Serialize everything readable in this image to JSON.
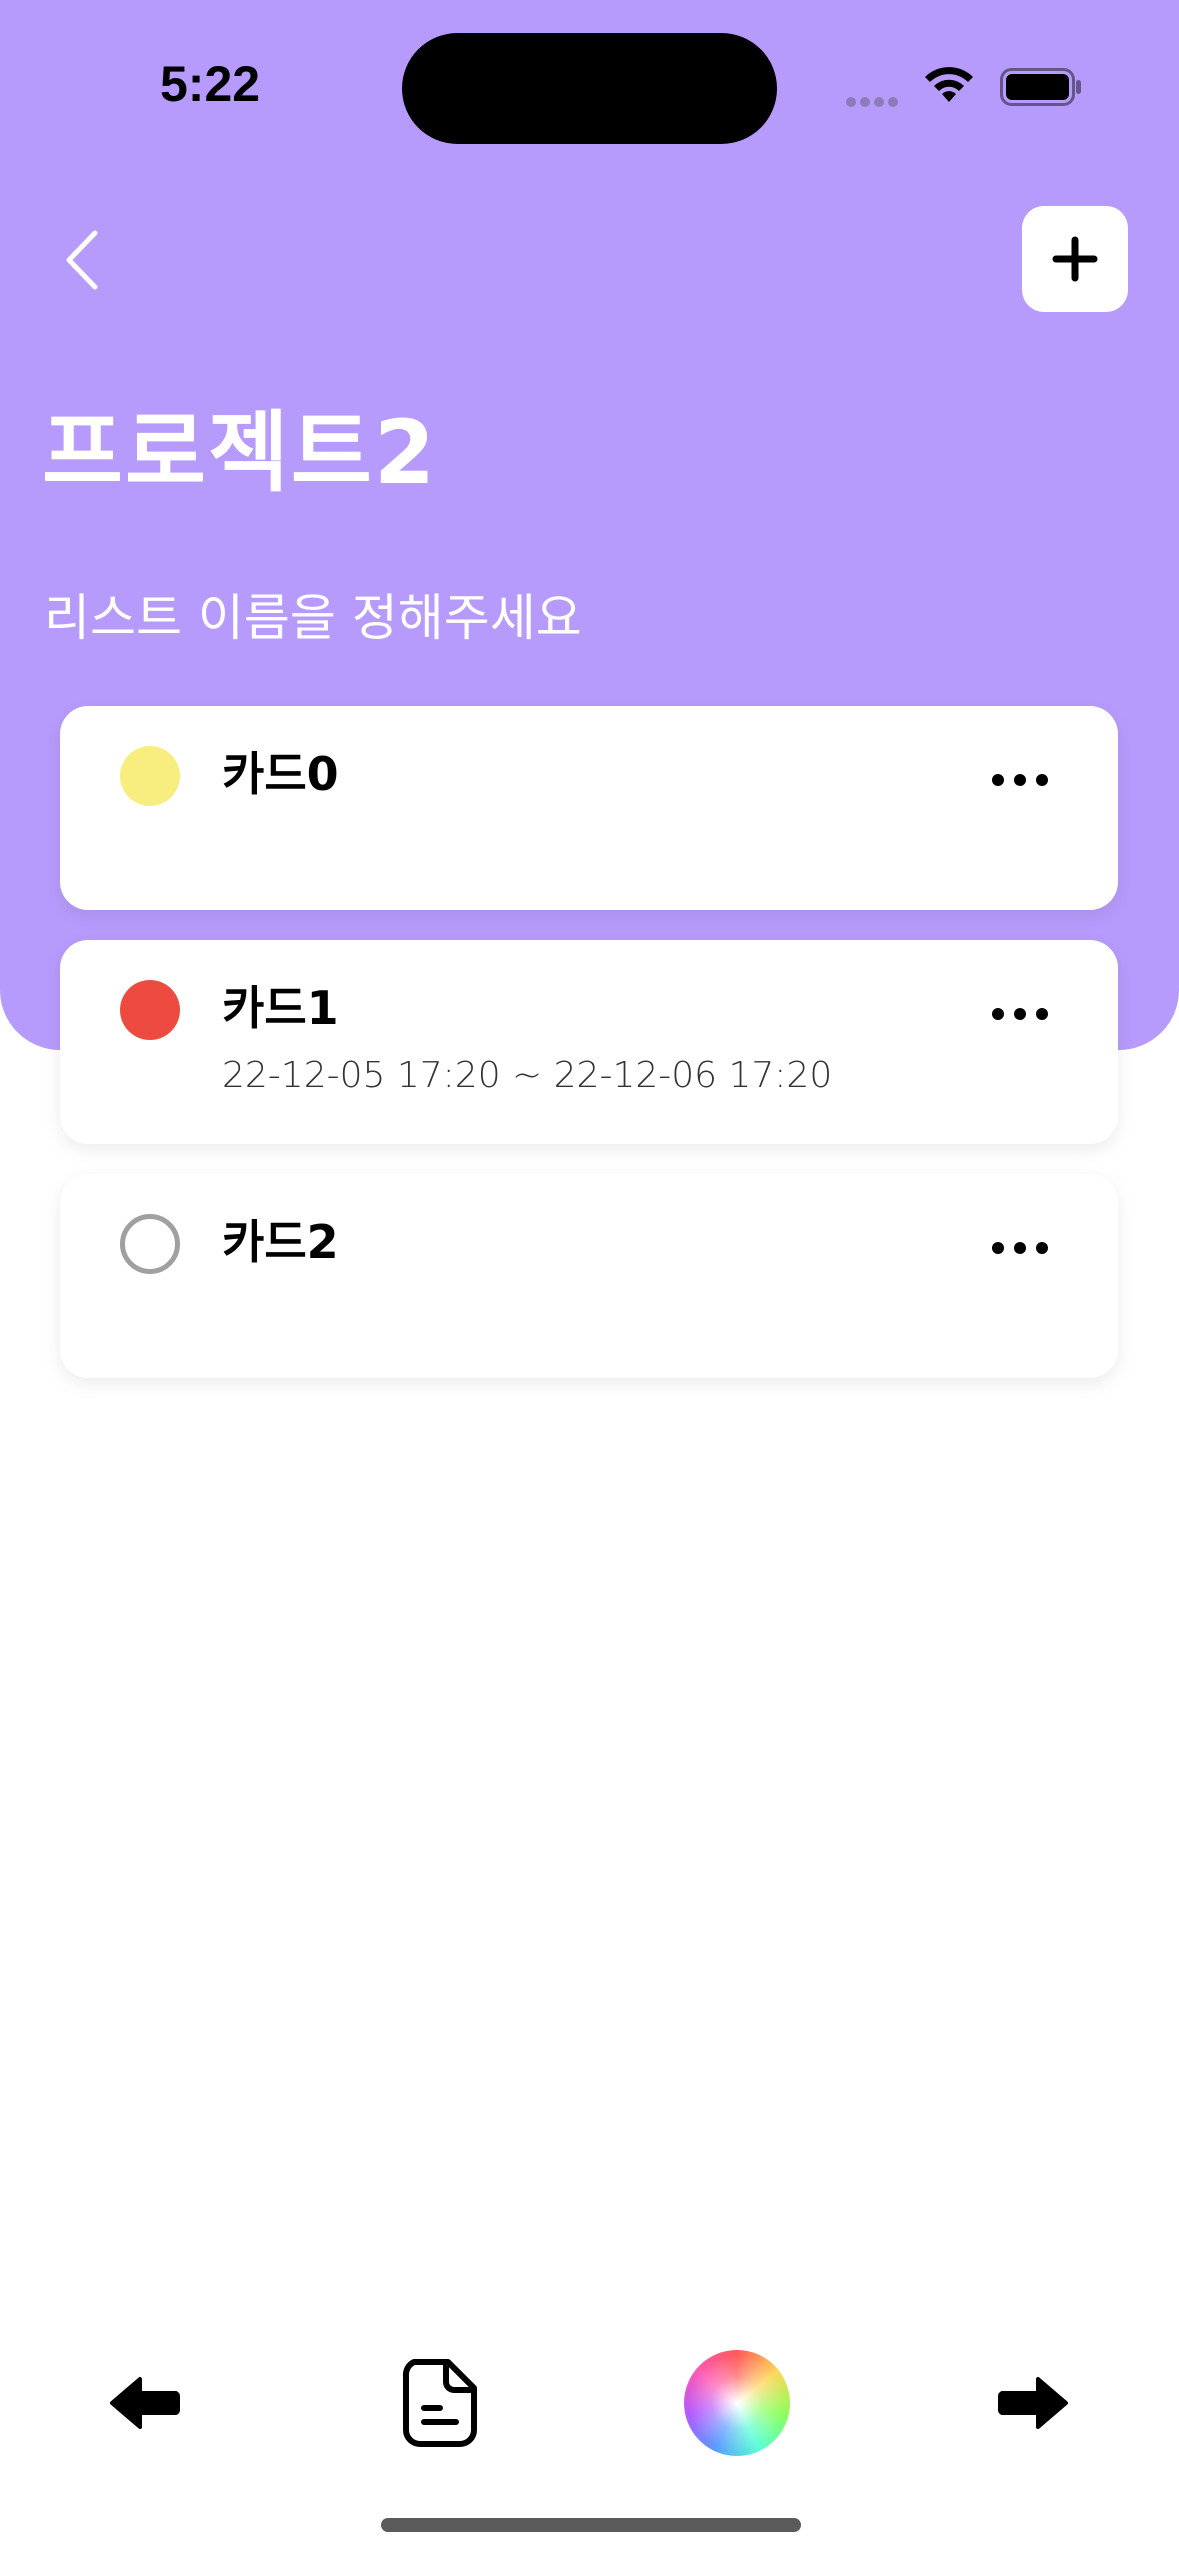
{
  "status": {
    "time": "5:22"
  },
  "header": {
    "title": "프로젝트2",
    "subtitle": "리스트 이름을 정해주세요",
    "back_icon": "chevron-left-icon",
    "add_icon": "plus-icon"
  },
  "cards": [
    {
      "title": "카드0",
      "date": "",
      "dot_color": "#f8ee80",
      "dot_style": "filled"
    },
    {
      "title": "카드1",
      "date": "22-12-05 17:20  ~  22-12-06 17:20",
      "dot_color": "#ee4b40",
      "dot_style": "filled"
    },
    {
      "title": "카드2",
      "date": "",
      "dot_color": "#a0a0a0",
      "dot_style": "outline"
    }
  ],
  "toolbar": {
    "items": [
      "arrow-left-icon",
      "document-icon",
      "color-wheel-icon",
      "arrow-right-icon"
    ]
  },
  "colors": {
    "accent": "#b79bfc"
  }
}
